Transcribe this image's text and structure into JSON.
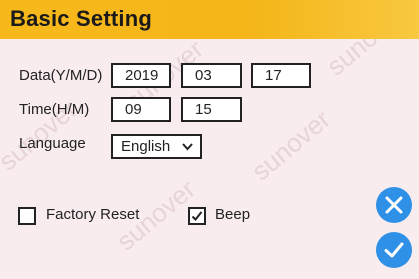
{
  "title": "Basic Setting",
  "date": {
    "label": "Data(Y/M/D)",
    "year": "2019",
    "month": "03",
    "day": "17"
  },
  "time": {
    "label": "Time(H/M)",
    "hour": "09",
    "minute": "15"
  },
  "language": {
    "label": "Language",
    "selected": "English"
  },
  "options": {
    "factory_reset": {
      "label": "Factory Reset",
      "checked": false
    },
    "beep": {
      "label": "Beep",
      "checked": true
    }
  },
  "watermark": "sunover",
  "colors": {
    "title_bar": "#f7b81a",
    "background": "#f8ecee",
    "action_button": "#2e90e6"
  },
  "icons": {
    "cancel": "close-icon",
    "confirm": "check-icon"
  }
}
